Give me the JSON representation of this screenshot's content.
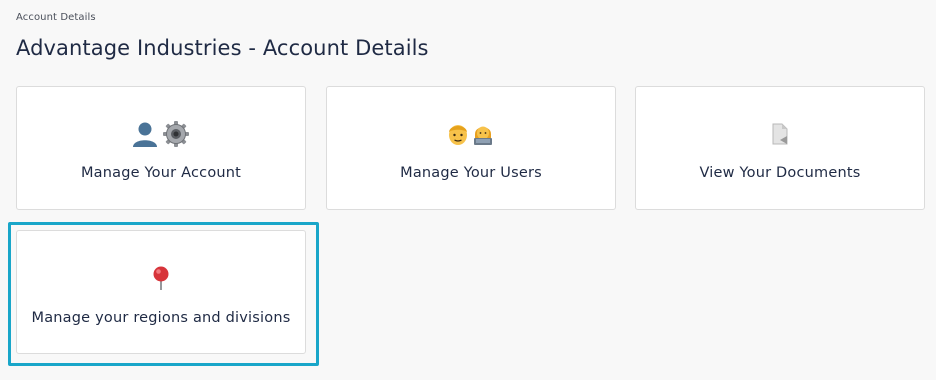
{
  "breadcrumb": "Account Details",
  "page_title": "Advantage Industries - Account Details",
  "cards": [
    {
      "label": "Manage Your Account",
      "icons": [
        "user-silhouette-icon",
        "gear-icon"
      ]
    },
    {
      "label": "Manage Your Users",
      "icons": [
        "man-face-icon",
        "person-at-laptop-icon"
      ]
    },
    {
      "label": "View Your Documents",
      "icons": [
        "document-icon"
      ]
    },
    {
      "label": "Manage your regions and divisions",
      "icons": [
        "pushpin-icon"
      ]
    }
  ],
  "colors": {
    "background": "#f8f8f8",
    "card_border": "#dcdcdc",
    "highlight": "#19a6c9",
    "text": "#1f2a44"
  }
}
